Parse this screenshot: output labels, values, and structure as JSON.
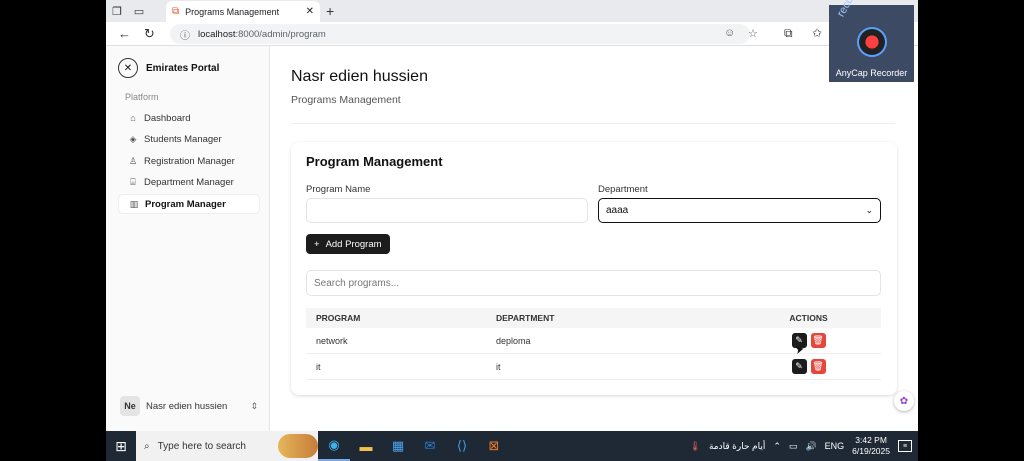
{
  "browser": {
    "tab_title": "Programs Management",
    "url_host": "localhost",
    "url_path": ":8000/admin/program"
  },
  "recorder": {
    "brand_text": "recordvideocall.com",
    "name": "AnyCap Recorder"
  },
  "sidebar": {
    "app_name": "Emirates Portal",
    "section_label": "Platform",
    "items": [
      {
        "label": "Dashboard",
        "icon": "home-icon"
      },
      {
        "label": "Students Manager",
        "icon": "graduation-cap-icon"
      },
      {
        "label": "Registration Manager",
        "icon": "user-icon"
      },
      {
        "label": "Department Manager",
        "icon": "building-icon"
      },
      {
        "label": "Program Manager",
        "icon": "book-icon"
      }
    ],
    "active_item": "Program Manager",
    "user": {
      "initials": "Ne",
      "name": "Nasr edien hussien"
    }
  },
  "header": {
    "title": "Nasr edien hussien",
    "subtitle": "Programs Management"
  },
  "form": {
    "title": "Program Management",
    "program_name_label": "Program Name",
    "program_name_value": "",
    "department_label": "Department",
    "department_value": "aaaa",
    "add_button_label": "Add Program",
    "search_placeholder": "Search programs..."
  },
  "table": {
    "headers": [
      "PROGRAM",
      "DEPARTMENT",
      "ACTIONS"
    ],
    "rows": [
      {
        "program": "network",
        "department": "deploma"
      },
      {
        "program": "it",
        "department": "it"
      }
    ]
  },
  "taskbar": {
    "search_placeholder": "Type here to search",
    "weather_text": "أيام حارة قادمة",
    "language": "ENG",
    "time": "3:42 PM",
    "date": "6/19/2025"
  }
}
